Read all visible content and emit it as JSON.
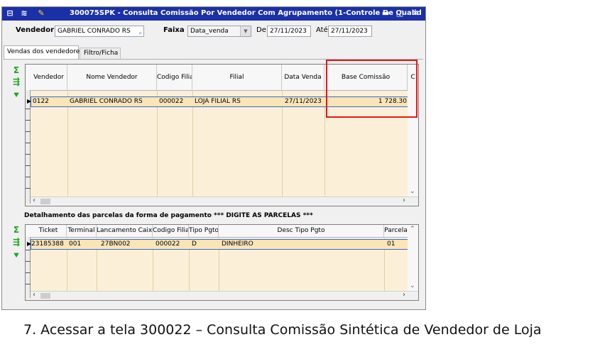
{
  "window": {
    "title": "300075SPK - Consulta Comissão Por Vendedor Com Agrupamento (1-Controle De Qualid",
    "controls": {
      "minimize": "▬",
      "maximize": "□",
      "close": "✕"
    }
  },
  "filters": {
    "vendedor_label": "Vendedor:",
    "vendedor_value": "GABRIEL CONRADO RS",
    "faixa_label": "Faixa",
    "faixa_value": "Data_venda",
    "de_label": "De",
    "de_value": "27/11/2023",
    "ate_label": "Até",
    "ate_value": "27/11/2023"
  },
  "tabs": [
    {
      "label": "Vendas dos vendedores",
      "active": true
    },
    {
      "label": "Filtro/Ficha",
      "active": false
    }
  ],
  "sales_grid": {
    "columns": [
      "Vendedor",
      "Nome Vendedor",
      "Codigo Filial",
      "Filial",
      "Data Venda",
      "Base Comissão",
      "C"
    ],
    "rows": [
      [
        "0122",
        "GABRIEL CONRADO RS",
        "000022",
        "LOJA FILIAL RS",
        "27/11/2023",
        "1 728.30"
      ]
    ]
  },
  "detail_section": {
    "title": "Detalhamento das parcelas da forma de pagamento *** DIGITE AS PARCELAS ***"
  },
  "detail_grid": {
    "columns": [
      "Ticket",
      "Terminal",
      "Lancamento Caixa",
      "Codigo Filial",
      "Tipo Pgto",
      "Desc Tipo Pgto",
      "Parcela"
    ],
    "rows": [
      [
        "23185388",
        "001",
        "27BN002",
        "000022",
        "D",
        "DINHEIRO",
        "01"
      ]
    ]
  },
  "caption": "7. Acessar a tela 300022 – Consulta Comissão Sintética de Vendedor de Loja",
  "colors": {
    "titlebar": "#1b30a8",
    "grid_bg": "#fbf0d7",
    "highlight": "#e8161a",
    "icon_green": "#19a61e"
  }
}
